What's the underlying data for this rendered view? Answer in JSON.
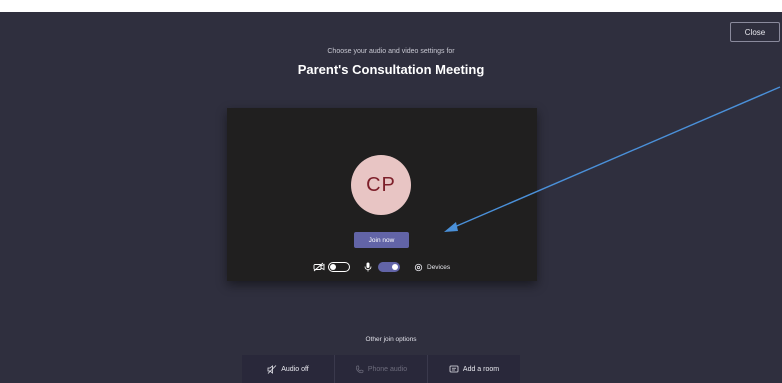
{
  "header": {
    "close_label": "Close",
    "subtitle": "Choose your audio and video settings for",
    "meeting_title": "Parent's Consultation Meeting"
  },
  "preview": {
    "avatar_initials": "CP",
    "join_label": "Join now",
    "camera_toggle": "off",
    "mic_toggle": "on",
    "devices_label": "Devices"
  },
  "other_join": {
    "heading": "Other join options",
    "options": [
      {
        "label": "Audio off",
        "icon": "speaker-off-icon",
        "enabled": true
      },
      {
        "label": "Phone audio",
        "icon": "phone-icon",
        "enabled": false
      },
      {
        "label": "Add a room",
        "icon": "room-icon",
        "enabled": true
      }
    ]
  },
  "colors": {
    "background": "#2f2f3e",
    "preview_background": "#201f1f",
    "accent": "#6264a7",
    "avatar_background": "#e8c5c4",
    "avatar_text": "#7d1f2a",
    "annotation_arrow": "#4a90d9"
  },
  "annotation": {
    "type": "arrow",
    "points_to": "join-now-button"
  }
}
